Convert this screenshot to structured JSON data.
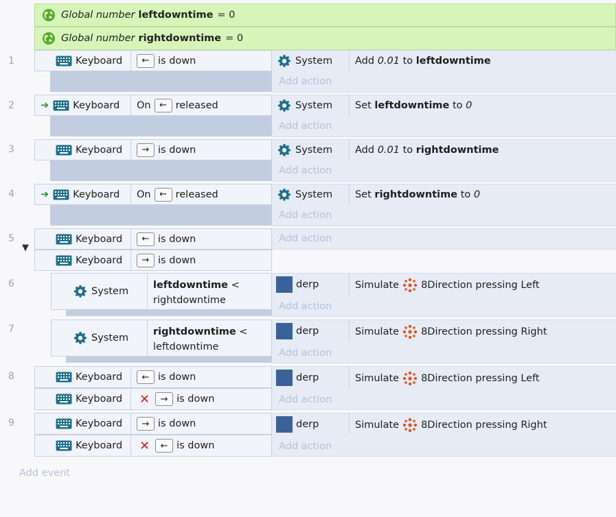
{
  "globals": [
    {
      "label": "Global number",
      "name": "leftdowntime",
      "eq": "= 0"
    },
    {
      "label": "Global number",
      "name": "rightdowntime",
      "eq": "= 0"
    }
  ],
  "events": [
    {
      "num": "1",
      "obj": "Keyboard",
      "pre": "",
      "key": "←",
      "post": "is down",
      "act_obj": "System",
      "act_a": "Add ",
      "act_b": "0.01",
      "act_c": " to ",
      "act_d": "leftdowntime",
      "add": "Add action"
    },
    {
      "num": "2",
      "obj": "Keyboard",
      "pre": "On",
      "key": "←",
      "post": "released",
      "act_obj": "System",
      "act_a": "Set ",
      "act_b": "leftdowntime",
      "act_c": " to ",
      "act_d": "0",
      "add": "Add action"
    },
    {
      "num": "3",
      "obj": "Keyboard",
      "pre": "",
      "key": "→",
      "post": "is down",
      "act_obj": "System",
      "act_a": "Add ",
      "act_b": "0.01",
      "act_c": " to ",
      "act_d": "rightdowntime",
      "add": "Add action"
    },
    {
      "num": "4",
      "obj": "Keyboard",
      "pre": "On",
      "key": "←",
      "post": "released",
      "act_obj": "System",
      "act_a": "Set ",
      "act_b": "rightdowntime",
      "act_c": " to ",
      "act_d": "0",
      "add": "Add action"
    }
  ],
  "event5": {
    "num": "5",
    "obj": "Keyboard",
    "key1": "←",
    "key2": "→",
    "post": "is down",
    "add": "Add action"
  },
  "event6": {
    "num": "6",
    "obj": "System",
    "var1": "leftdowntime",
    "op": "<",
    "var2": "rightdowntime",
    "act_obj": "derp",
    "act_verb": "Simulate",
    "act_rest": "8Direction pressing Left",
    "add": "Add action"
  },
  "event7": {
    "num": "7",
    "obj": "System",
    "var1": "rightdowntime",
    "op": "<",
    "var2": "leftdowntime",
    "act_obj": "derp",
    "act_verb": "Simulate",
    "act_rest": "8Direction pressing Right",
    "add": "Add action"
  },
  "event8": {
    "num": "8",
    "obj": "Keyboard",
    "key1": "←",
    "key2": "→",
    "post": "is down",
    "act_obj": "derp",
    "act_verb": "Simulate",
    "act_rest": "8Direction pressing Left",
    "add": "Add action"
  },
  "event9": {
    "num": "9",
    "obj": "Keyboard",
    "key1": "→",
    "key2": "←",
    "post": "is down",
    "act_obj": "derp",
    "act_verb": "Simulate",
    "act_rest": "8Direction pressing Right",
    "add": "Add action"
  },
  "add_event": "Add event",
  "colors": {
    "global_bg": "#d7f5b9",
    "condition_bg": "#f1f4fa",
    "action_bg": "#e6ebf6",
    "accent_gear": "#1f6f8b",
    "derp": "#3a6296",
    "invert_x": "#e0181c",
    "trigger_arrow": "#2b9a2b"
  }
}
